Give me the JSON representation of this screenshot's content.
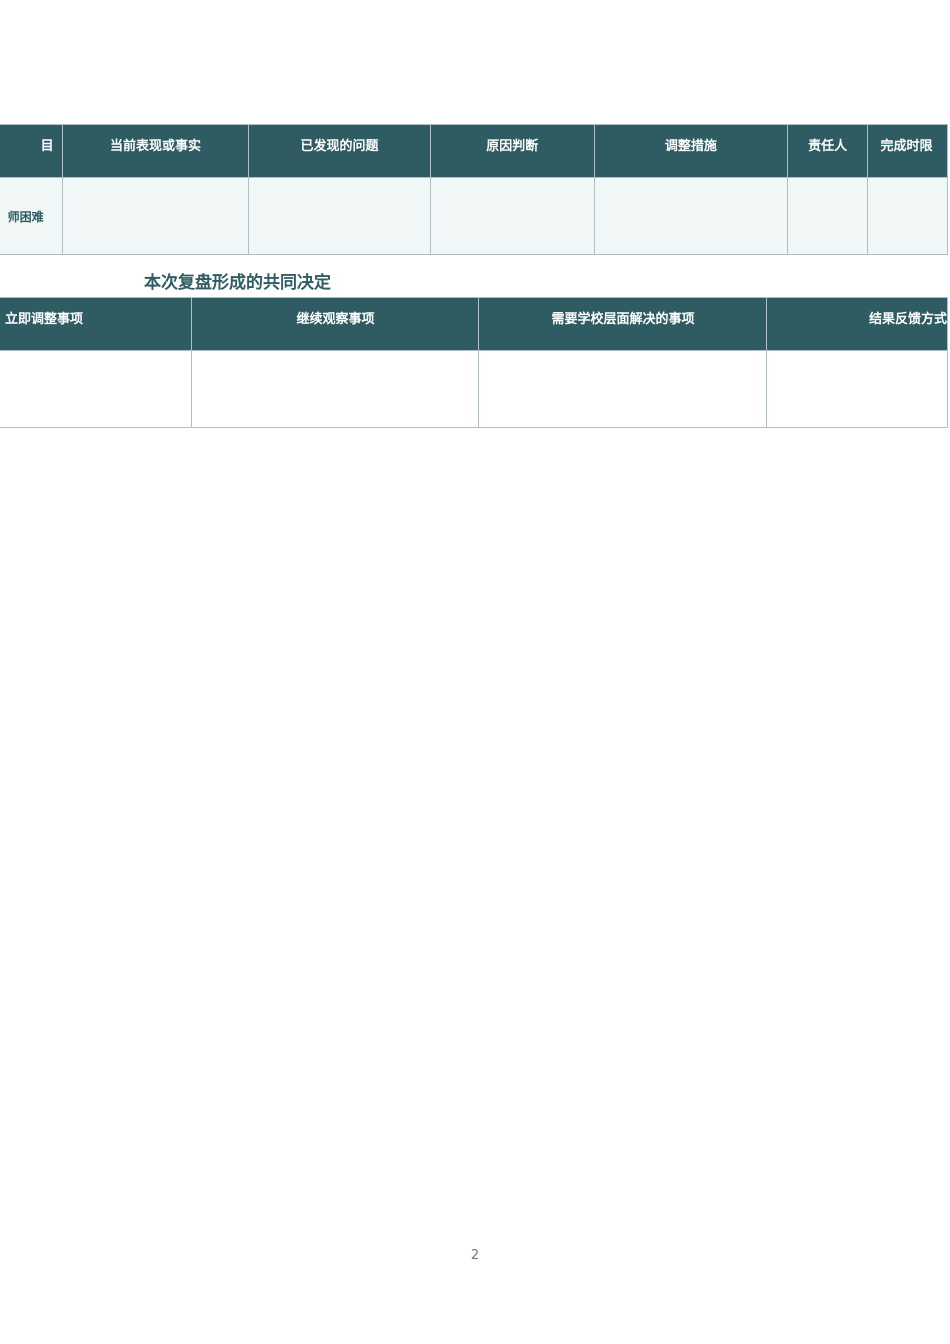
{
  "review_table": {
    "headers": [
      "目",
      "当前表现或事实",
      "已发现的问题",
      "原因判断",
      "调整措施",
      "责任人",
      "完成时限"
    ],
    "rows": [
      [
        "师困难",
        "",
        "",
        "",
        "",
        "",
        ""
      ]
    ]
  },
  "decision_section": {
    "title": "本次复盘形成的共同决定"
  },
  "decision_table": {
    "headers": [
      "立即调整事项",
      "继续观察事项",
      "需要学校层面解决的事项",
      "结果反馈方式"
    ],
    "rows": [
      [
        "",
        "",
        "",
        ""
      ]
    ]
  },
  "footer": {
    "page_number": "2"
  },
  "colors": {
    "header_bg": "#2e5c62",
    "header_text": "#ffffff",
    "row_bg": "#f1f6f6",
    "border": "#aec0c2",
    "title_text": "#2f5d63"
  }
}
